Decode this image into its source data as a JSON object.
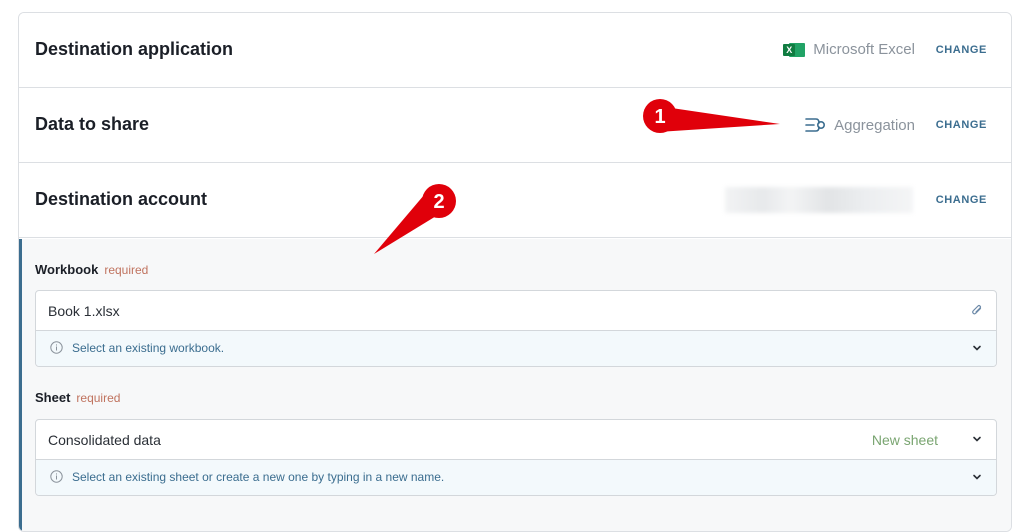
{
  "rows": [
    {
      "title": "Destination application",
      "value": "Microsoft Excel",
      "icon": "excel-icon",
      "change": "CHANGE"
    },
    {
      "title": "Data to share",
      "value": "Aggregation",
      "icon": "aggregation-icon",
      "change": "CHANGE"
    },
    {
      "title": "Destination account",
      "value": "",
      "change": "CHANGE"
    }
  ],
  "workbook": {
    "label": "Workbook",
    "required": "required",
    "value": "Book 1.xlsx",
    "hint": "Select an existing workbook."
  },
  "sheet": {
    "label": "Sheet",
    "required": "required",
    "value": "Consolidated data",
    "badge": "New sheet",
    "hint": "Select an existing sheet or create a new one by typing in a new name."
  },
  "annotations": {
    "one": "1",
    "two": "2"
  },
  "colors": {
    "accent": "#3b6d8f",
    "required": "#c0735f",
    "new_sheet": "#7aa571",
    "callout": "#e0000a"
  }
}
